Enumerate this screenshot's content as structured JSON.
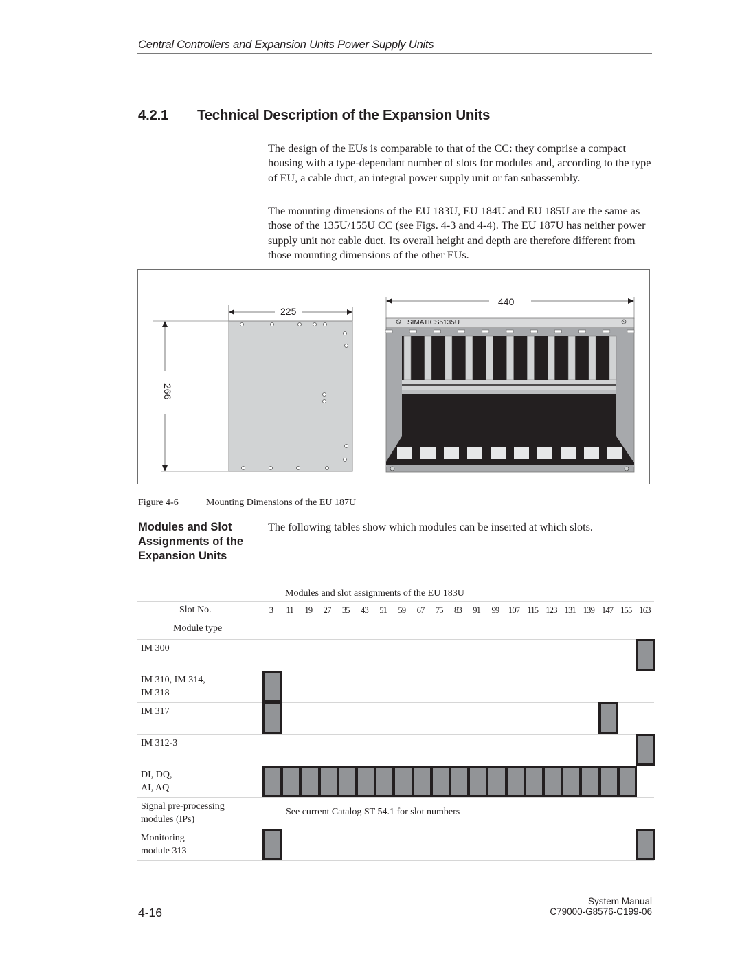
{
  "header": {
    "running_title": "Central Controllers and Expansion Units Power Supply Units"
  },
  "section": {
    "number": "4.2.1",
    "title": "Technical Description of the Expansion Units"
  },
  "paragraphs": [
    "The design of the EUs is comparable to that of the CC: they comprise a compact housing with a type-dependant number of slots for modules and, according to the type of EU, a cable duct, an integral power supply unit or fan subassembly.",
    "The mounting dimensions of the EU 183U, EU 184U and EU 185U are the same as those of the 135U/155U CC (see Figs. 4-3 and 4-4). The EU 187U has neither power supply unit nor cable duct. Its overall height and depth are therefore different from those mounting dimensions of the other EUs."
  ],
  "figure": {
    "side_view": {
      "width_label": "225",
      "height_label": "266",
      "panel_color": "#d1d3d4"
    },
    "front_view": {
      "width_label": "440",
      "brand_label": "SIMATICS5135U",
      "slot_count": 11,
      "dark_color": "#231f20",
      "light_color": "#d1d3d4"
    },
    "caption_label": "Figure 4-6",
    "caption_text": "Mounting Dimensions of the EU 187U"
  },
  "modules_section": {
    "side_heading": "Modules and Slot Assignments of the Expansion Units",
    "intro": "The following tables show which modules can be inserted at which slots."
  },
  "slot_table": {
    "title": "Modules and slot assignments of the EU 183U",
    "slot_header": "Slot No.",
    "module_header": "Module type",
    "slots": [
      "3",
      "11",
      "19",
      "27",
      "35",
      "43",
      "51",
      "59",
      "67",
      "75",
      "83",
      "91",
      "99",
      "107",
      "115",
      "123",
      "131",
      "139",
      "147",
      "155",
      "163"
    ],
    "cell_color": "#929497",
    "rows": [
      {
        "label_lines": [
          "IM 300"
        ],
        "allowed_slots": [
          "163"
        ]
      },
      {
        "label_lines": [
          "IM 310, IM 314,",
          "IM 318"
        ],
        "allowed_slots": [
          "3"
        ]
      },
      {
        "label_lines": [
          "IM 317"
        ],
        "allowed_slots": [
          "3",
          "147"
        ]
      },
      {
        "label_lines": [
          "IM 312-3"
        ],
        "allowed_slots": [
          "163"
        ]
      },
      {
        "label_lines": [
          "DI, DQ,",
          "AI, AQ"
        ],
        "allowed_slots": [
          "3",
          "11",
          "19",
          "27",
          "35",
          "43",
          "51",
          "59",
          "67",
          "75",
          "83",
          "91",
          "99",
          "107",
          "115",
          "123",
          "131",
          "139",
          "147",
          "155"
        ]
      },
      {
        "label_lines": [
          "Signal pre-processing",
          "modules (IPs)"
        ],
        "allowed_slots": [],
        "note": "See current Catalog ST 54.1 for slot numbers"
      },
      {
        "label_lines": [
          "Monitoring",
          "module 313"
        ],
        "allowed_slots": [
          "3",
          "163"
        ]
      }
    ]
  },
  "footer": {
    "page_number": "4-16",
    "manual_title": "System Manual",
    "document_number": "C79000-G8576-C199-06"
  }
}
